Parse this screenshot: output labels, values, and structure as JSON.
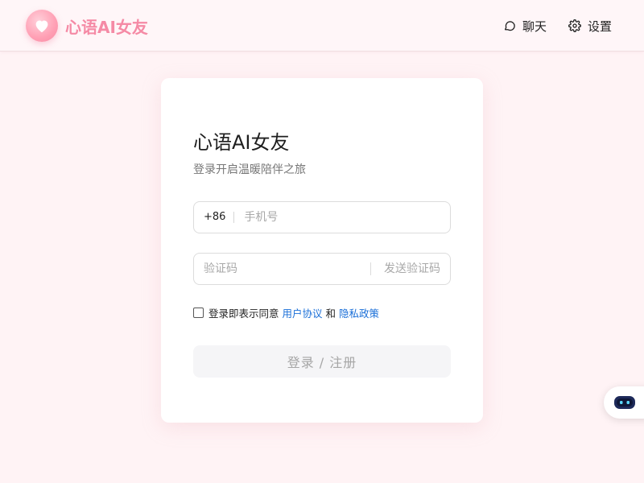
{
  "header": {
    "brand": "心语AI女友",
    "nav": [
      {
        "label": "聊天",
        "icon": "chat-bubble-icon"
      },
      {
        "label": "设置",
        "icon": "gear-icon"
      }
    ]
  },
  "login": {
    "title": "心语AI女友",
    "subtitle": "登录开启温暖陪伴之旅",
    "country_code": "+86",
    "phone_placeholder": "手机号",
    "code_placeholder": "验证码",
    "send_code_label": "发送验证码",
    "agreement_prefix": "登录即表示同意",
    "user_agreement": "用户协议",
    "and": "和",
    "privacy_policy": "隐私政策",
    "submit_label": "登录 / 注册"
  },
  "colors": {
    "brand": "#f58aa5",
    "link": "#1a6fd8",
    "background": "#fff3f5"
  }
}
